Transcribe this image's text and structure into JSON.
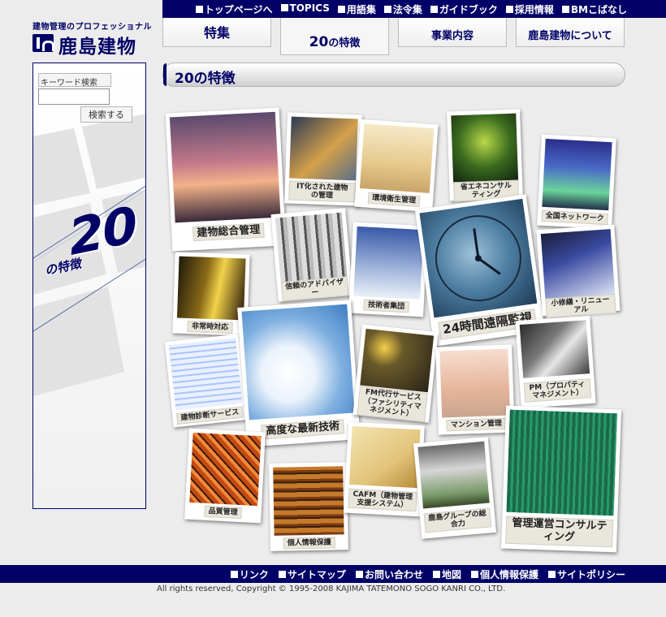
{
  "header": {
    "tagline": "建物管理のプロフェッショナル",
    "company_name": "鹿島建物",
    "top_links": [
      "トップページへ",
      "TOPICS",
      "用語集",
      "法令集",
      "ガイドブック",
      "採用情報",
      "BMこばなし"
    ]
  },
  "tabs": {
    "feature": "特集",
    "twenty_num": "20",
    "twenty_suffix": "の特徴",
    "business": "事業内容",
    "about": "鹿島建物について"
  },
  "sidebar": {
    "keyword_label": "キーワード検索",
    "search_input_value": "",
    "search_button": "検索する",
    "banner_number": "20",
    "banner_text": "の特徴"
  },
  "section": {
    "title": "20の特徴"
  },
  "features": [
    "建物総合管理",
    "IT化された建物の管理",
    "環境衛生管理",
    "省エネコンサルティング",
    "全国ネットワーク",
    "信頼のアドバイザー",
    "技術者集団",
    "24時間遠隔監視",
    "非常時対応",
    "小修繕・リニューアル",
    "建物診断サービス",
    "高度な最新技術",
    "FM代行サービス（ファシリティマネジメント）",
    "マンション管理",
    "PM（プロパティマネジメント）",
    "品質管理",
    "個人情報保護",
    "CAFM（建物管理支援システム）",
    "鹿島グループの総合力",
    "管理運営コンサルティング"
  ],
  "footer": {
    "links": [
      "リンク",
      "サイトマップ",
      "お問い合わせ",
      "地図",
      "個人情報保護",
      "サイトポリシー"
    ],
    "copyright": "All rights reserved, Copyright © 1995-2008 KAJIMA TATEMONO SOGO KANRI CO., LTD."
  },
  "colors": {
    "brand_navy": "#000066",
    "background": "#ececec"
  }
}
